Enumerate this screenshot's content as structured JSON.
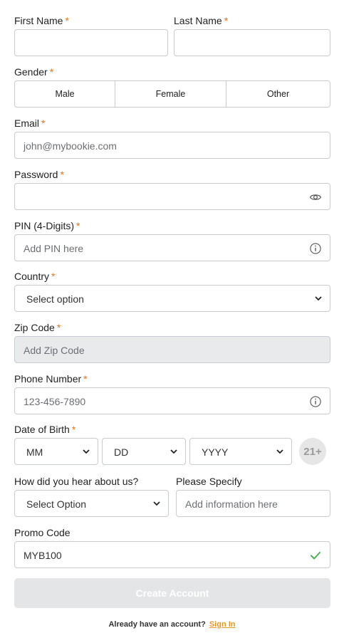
{
  "form": {
    "first_name": {
      "label": "First Name",
      "value": ""
    },
    "last_name": {
      "label": "Last Name",
      "value": ""
    },
    "gender": {
      "label": "Gender",
      "options": [
        "Male",
        "Female",
        "Other"
      ]
    },
    "email": {
      "label": "Email",
      "placeholder": "john@mybookie.com"
    },
    "password": {
      "label": "Password",
      "icon": "eye-icon"
    },
    "pin": {
      "label": "PIN (4-Digits)",
      "placeholder": "Add PIN here",
      "icon": "info-icon"
    },
    "country": {
      "label": "Country",
      "selected": "Select option"
    },
    "zip": {
      "label": "Zip Code",
      "placeholder": "Add Zip Code"
    },
    "phone": {
      "label": "Phone Number",
      "placeholder": "123-456-7890",
      "icon": "info-icon"
    },
    "dob": {
      "label": "Date of Birth",
      "month": "MM",
      "day": "DD",
      "year": "YYYY",
      "age_badge": "21+"
    },
    "hear": {
      "label": "How did you hear about us?",
      "selected": "Select Option"
    },
    "specify": {
      "label": "Please Specify",
      "placeholder": "Add information here"
    },
    "promo": {
      "label": "Promo Code",
      "value": "MYB100",
      "icon": "check-icon"
    },
    "required_mark": "*"
  },
  "submit": {
    "label": "Create Account"
  },
  "footer": {
    "text": "Already have an account?",
    "link": "Sign In"
  },
  "colors": {
    "required": "#e8731a",
    "link": "#e8961a",
    "check": "#4caf50",
    "button_disabled": "#e4e5e7"
  }
}
